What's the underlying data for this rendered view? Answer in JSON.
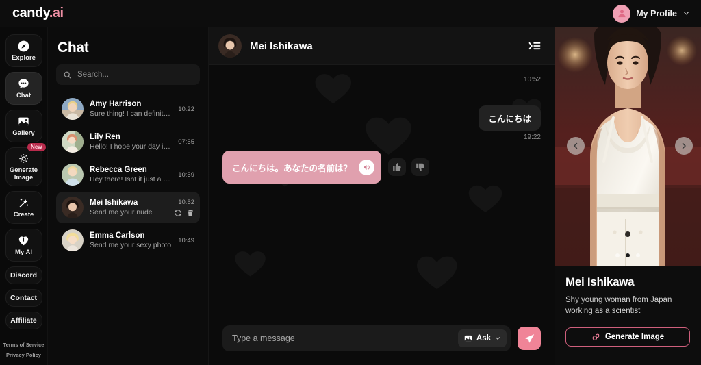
{
  "brand": {
    "name_white": "candy",
    "name_pink": ".ai"
  },
  "topbar": {
    "profile_label": "My Profile",
    "avatar_icon": "user-avatar-icon",
    "chevron_icon": "chevron-down-icon"
  },
  "sidebar": {
    "items": [
      {
        "label": "Explore",
        "icon": "compass-icon",
        "active": false
      },
      {
        "label": "Chat",
        "icon": "chat-bubble-icon",
        "active": true
      },
      {
        "label": "Gallery",
        "icon": "image-icon",
        "active": false
      },
      {
        "label": "Generate Image",
        "icon": "gear-sparkle-icon",
        "active": false,
        "badge": "New"
      },
      {
        "label": "Create",
        "icon": "magic-wand-icon",
        "active": false
      },
      {
        "label": "My AI",
        "icon": "heart-icon",
        "active": false
      }
    ],
    "links": [
      {
        "label": "Discord"
      },
      {
        "label": "Contact"
      },
      {
        "label": "Affiliate"
      }
    ],
    "legal": [
      {
        "label": "Terms of Service"
      },
      {
        "label": "Privacy Policy"
      }
    ]
  },
  "chatlist": {
    "title": "Chat",
    "search": {
      "placeholder": "Search...",
      "value": "",
      "icon": "search-icon"
    },
    "conversations": [
      {
        "name": "Amy Harrison",
        "preview": "Sure thing! I can definitel...",
        "time": "10:22",
        "active": false
      },
      {
        "name": "Lily Ren",
        "preview": "Hello! I hope your day is g...",
        "time": "07:55",
        "active": false
      },
      {
        "name": "Rebecca Green",
        "preview": "Hey there! Isnt it just a p...",
        "time": "10:59",
        "active": false
      },
      {
        "name": "Mei Ishikawa",
        "preview": "Send me your nude",
        "time": "10:52",
        "active": true,
        "actions": [
          "refresh-icon",
          "trash-icon"
        ]
      },
      {
        "name": "Emma Carlson",
        "preview": "Send me your sexy photo",
        "time": "10:49",
        "active": false
      }
    ]
  },
  "conversation": {
    "header": {
      "title": "Mei Ishikawa",
      "collapse_icon": "collapse-panel-icon",
      "avatar": "mei-avatar"
    },
    "timestamps": {
      "first": "10:52",
      "second": "19:22"
    },
    "messages": [
      {
        "from": "user",
        "text": "こんにちは"
      },
      {
        "from": "ai",
        "text": "こんにちは。あなたの名前は？",
        "speaker_icon": "speaker-icon",
        "reactions": [
          "thumbs-up-icon",
          "thumbs-down-icon"
        ]
      }
    ],
    "composer": {
      "placeholder": "Type a message",
      "value": "",
      "ask_label": "Ask",
      "ask_icon": "image-icon",
      "ask_chevron": "chevron-down-icon",
      "send_icon": "send-icon"
    }
  },
  "rightpanel": {
    "name": "Mei Ishikawa",
    "description": "Shy young woman from Japan working as a scientist",
    "generate_button": {
      "label": "Generate Image",
      "icon": "generate-image-icon"
    },
    "carousel": {
      "prev_icon": "chevron-left-icon",
      "next_icon": "chevron-right-icon",
      "dots": 3,
      "active_dot": 1
    }
  },
  "colors": {
    "accent_pink": "#f08497",
    "bubble_pink": "#e0a0ae",
    "badge": "#b92b4c",
    "background": "#0a0a0a"
  }
}
